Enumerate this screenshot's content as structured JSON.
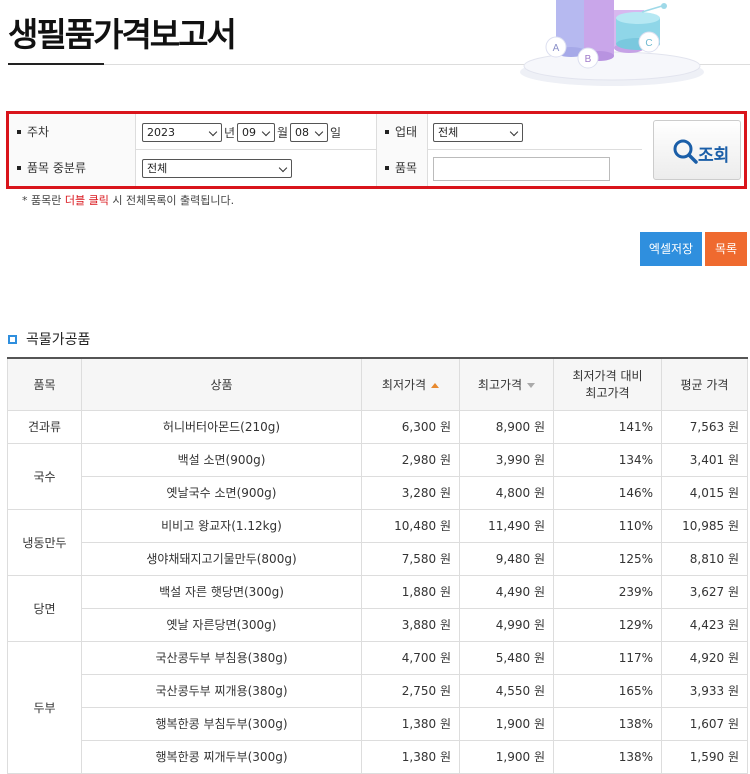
{
  "page": {
    "title": "생필품가격보고서"
  },
  "hero": {
    "cyl_a": "A",
    "cyl_b": "B",
    "cyl_c": "C"
  },
  "search": {
    "week_label": "주차",
    "year": "2023",
    "year_unit": "년",
    "month": "09",
    "month_unit": "월",
    "day": "08",
    "day_unit": "일",
    "business_label": "업태",
    "business_value": "전체",
    "category_label": "품목 중분류",
    "category_value": "전체",
    "item_label": "품목",
    "item_value": "",
    "button_label": "조회"
  },
  "hint": {
    "prefix": "* 품목란 ",
    "highlight": "더블 클릭",
    "suffix": " 시 전체목록이 출력됩니다."
  },
  "actions": {
    "excel_label": "엑셀저장",
    "list_label": "목록"
  },
  "section": {
    "title": "곡물가공품"
  },
  "table": {
    "headers": {
      "item": "품목",
      "product": "상품",
      "min": "최저가격",
      "max": "최고가격",
      "ratio_line1": "최저가격 대비",
      "ratio_line2": "최고가격",
      "avg": "평균 가격"
    },
    "groups": [
      {
        "item": "견과류",
        "rows": [
          {
            "product": "허니버터아몬드(210g)",
            "min": "6,300 원",
            "max": "8,900 원",
            "ratio": "141%",
            "avg": "7,563 원"
          }
        ]
      },
      {
        "item": "국수",
        "rows": [
          {
            "product": "백설 소면(900g)",
            "min": "2,980 원",
            "max": "3,990 원",
            "ratio": "134%",
            "avg": "3,401 원"
          },
          {
            "product": "옛날국수 소면(900g)",
            "min": "3,280 원",
            "max": "4,800 원",
            "ratio": "146%",
            "avg": "4,015 원"
          }
        ]
      },
      {
        "item": "냉동만두",
        "rows": [
          {
            "product": "비비고 왕교자(1.12kg)",
            "min": "10,480 원",
            "max": "11,490 원",
            "ratio": "110%",
            "avg": "10,985 원"
          },
          {
            "product": "생야채돼지고기물만두(800g)",
            "min": "7,580 원",
            "max": "9,480 원",
            "ratio": "125%",
            "avg": "8,810 원"
          }
        ]
      },
      {
        "item": "당면",
        "rows": [
          {
            "product": "백설 자른 햇당면(300g)",
            "min": "1,880 원",
            "max": "4,490 원",
            "ratio": "239%",
            "avg": "3,627 원"
          },
          {
            "product": "옛날 자른당면(300g)",
            "min": "3,880 원",
            "max": "4,990 원",
            "ratio": "129%",
            "avg": "4,423 원"
          }
        ]
      },
      {
        "item": "두부",
        "rows": [
          {
            "product": "국산콩두부 부침용(380g)",
            "min": "4,700 원",
            "max": "5,480 원",
            "ratio": "117%",
            "avg": "4,920 원"
          },
          {
            "product": "국산콩두부 찌개용(380g)",
            "min": "2,750 원",
            "max": "4,550 원",
            "ratio": "165%",
            "avg": "3,933 원"
          },
          {
            "product": "행복한콩 부침두부(300g)",
            "min": "1,380 원",
            "max": "1,900 원",
            "ratio": "138%",
            "avg": "1,607 원"
          },
          {
            "product": "행복한콩 찌개두부(300g)",
            "min": "1,380 원",
            "max": "1,900 원",
            "ratio": "138%",
            "avg": "1,590 원"
          }
        ]
      }
    ]
  }
}
